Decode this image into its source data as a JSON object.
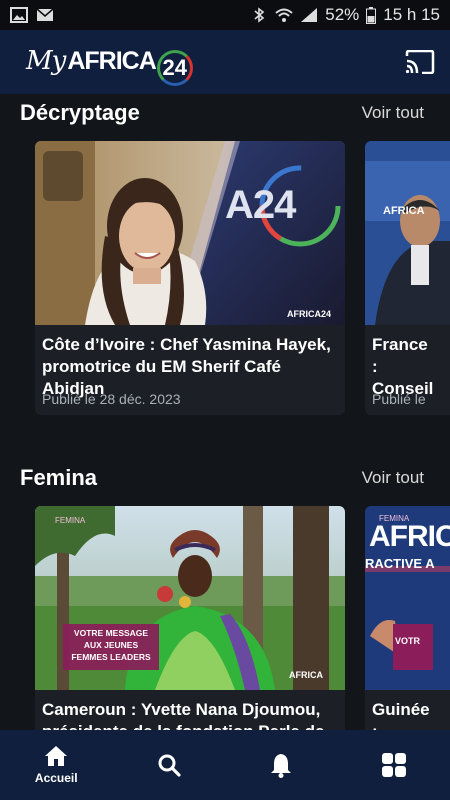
{
  "status_bar": {
    "battery": "52%",
    "time": "15 h 15"
  },
  "header": {
    "logo_my": "My",
    "logo_africa": "AFRICA",
    "logo_24": "24"
  },
  "sections": [
    {
      "title": "Décryptage",
      "see_all": "Voir tout",
      "cards": [
        {
          "title": "Côte d’Ivoire : Chef Yasmina Hayek, promotrice du EM Sherif Café Abidjan",
          "date": "Publié le 28 déc. 2023",
          "brand_badge": "A24",
          "watermark": "AFRICA24"
        },
        {
          "title": "France : Conseil",
          "date": "Publié le",
          "watermark": "AFRICA"
        }
      ]
    },
    {
      "title": "Femina",
      "see_all": "Voir tout",
      "cards": [
        {
          "title": "Cameroun : Yvette Nana Djoumou, présidente de la fondation Perle de F...",
          "overlay": "VOTRE MESSAGE AUX JEUNES FEMMES LEADERS",
          "tag": "FEMINA",
          "watermark": "AFRICA"
        },
        {
          "title": "Guinée : TCHAT",
          "thumb_text": "AFRIC",
          "thumb_sub": "RACTIVE A",
          "tag": "FEMINA",
          "side": "VOTR"
        }
      ]
    }
  ],
  "bottom_nav": [
    {
      "label": "Accueil",
      "icon": "home-icon",
      "active": true
    },
    {
      "label": "",
      "icon": "search-icon"
    },
    {
      "label": "",
      "icon": "bell-icon"
    },
    {
      "label": "",
      "icon": "grid-icon"
    }
  ],
  "colors": {
    "header_bg": "#0f1f3d",
    "page_bg": "#121519",
    "card_bg": "#1c2026",
    "overlay_magenta": "#8a1d5a"
  }
}
